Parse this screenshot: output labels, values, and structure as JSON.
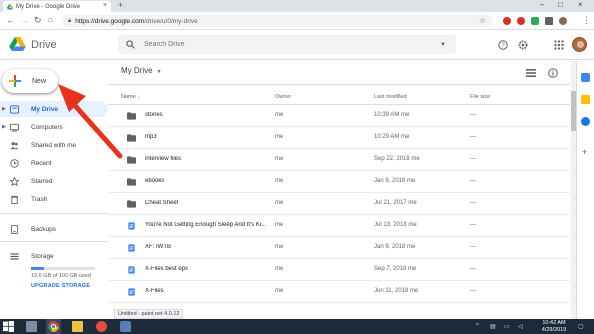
{
  "browser": {
    "tab_title": "My Drive - Google Drive",
    "tab_close": "×",
    "new_tab": "+",
    "url_host": "https://drive.google.com",
    "url_path": "/drive/u/0/my-drive",
    "win_min": "–",
    "win_max": "□",
    "win_close": "×"
  },
  "header": {
    "brand": "Drive",
    "search_placeholder": "Search Drive"
  },
  "sidebar": {
    "new_label": "New",
    "items": [
      {
        "label": "My Drive",
        "icon": "my-drive-icon"
      },
      {
        "label": "Computers",
        "icon": "computer-icon"
      },
      {
        "label": "Shared with me",
        "icon": "people-icon"
      },
      {
        "label": "Recent",
        "icon": "clock-icon"
      },
      {
        "label": "Starred",
        "icon": "star-icon"
      },
      {
        "label": "Trash",
        "icon": "trash-icon"
      },
      {
        "label": "Backups",
        "icon": "backup-icon"
      },
      {
        "label": "Storage",
        "icon": "storage-icon"
      }
    ],
    "storage_text": "19.6 GB of 100 GB used",
    "storage_fraction": 0.196,
    "upgrade": "UPGRADE STORAGE"
  },
  "main": {
    "title": "My Drive",
    "columns": {
      "name": "Name",
      "owner": "Owner",
      "modified": "Last modified",
      "size": "File size"
    },
    "files": [
      {
        "name": "stories",
        "type": "folder",
        "owner": "me",
        "modified": "10:39 AM me",
        "size": "—"
      },
      {
        "name": "mp3",
        "type": "folder",
        "owner": "me",
        "modified": "10:29 AM me",
        "size": "—"
      },
      {
        "name": "interview files",
        "type": "folder",
        "owner": "me",
        "modified": "Sep 22, 2018 me",
        "size": "—"
      },
      {
        "name": "ebooks",
        "type": "folder",
        "owner": "me",
        "modified": "Jan 9, 2018 me",
        "size": "—"
      },
      {
        "name": "Cheat Sheet",
        "type": "folder",
        "owner": "me",
        "modified": "Jul 21, 2017 me",
        "size": "—"
      },
      {
        "name": "You're Not Getting Enough Sleep And It's Ki...",
        "type": "doc",
        "owner": "me",
        "modified": "Jul 13, 2018 me",
        "size": "—"
      },
      {
        "name": "XF: IWTB",
        "type": "doc",
        "owner": "me",
        "modified": "Jan 9, 2018 me",
        "size": "—"
      },
      {
        "name": "X-Files best eps",
        "type": "doc",
        "owner": "me",
        "modified": "Sep 7, 2018 me",
        "size": "—"
      },
      {
        "name": "X-Files",
        "type": "doc",
        "owner": "me",
        "modified": "Jun 11, 2018 me",
        "size": "—"
      }
    ]
  },
  "status_tooltip": "Untitled - paint.net 4.0.12",
  "taskbar": {
    "time": "10:42 AM",
    "date": "4/29/2019"
  },
  "colors": {
    "drive_blue": "#4285f4",
    "drive_green": "#0f9d58",
    "drive_yellow": "#f4b400",
    "drive_red": "#db4437",
    "active_nav_bg": "#e8f0fe",
    "annotation_arrow": "#e8321c"
  }
}
